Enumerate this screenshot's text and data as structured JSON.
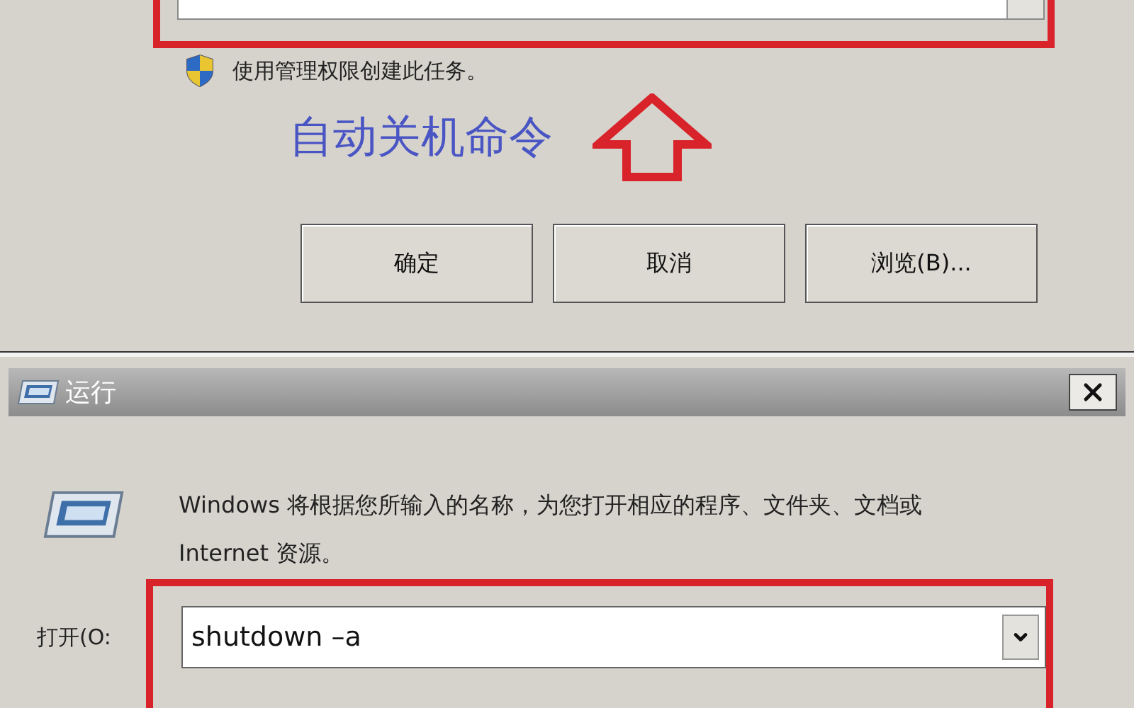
{
  "top_dialog": {
    "admin_note": "使用管理权限创建此任务。",
    "annotation": "自动关机命令",
    "buttons": [
      "确定",
      "取消",
      "浏览(B)..."
    ]
  },
  "run_dialog": {
    "title": "运行",
    "description": "Windows 将根据您所输入的名称，为您打开相应的程序、文件夹、文档或 Internet 资源。",
    "open_label": "打开(O:",
    "command": "shutdown –a"
  }
}
